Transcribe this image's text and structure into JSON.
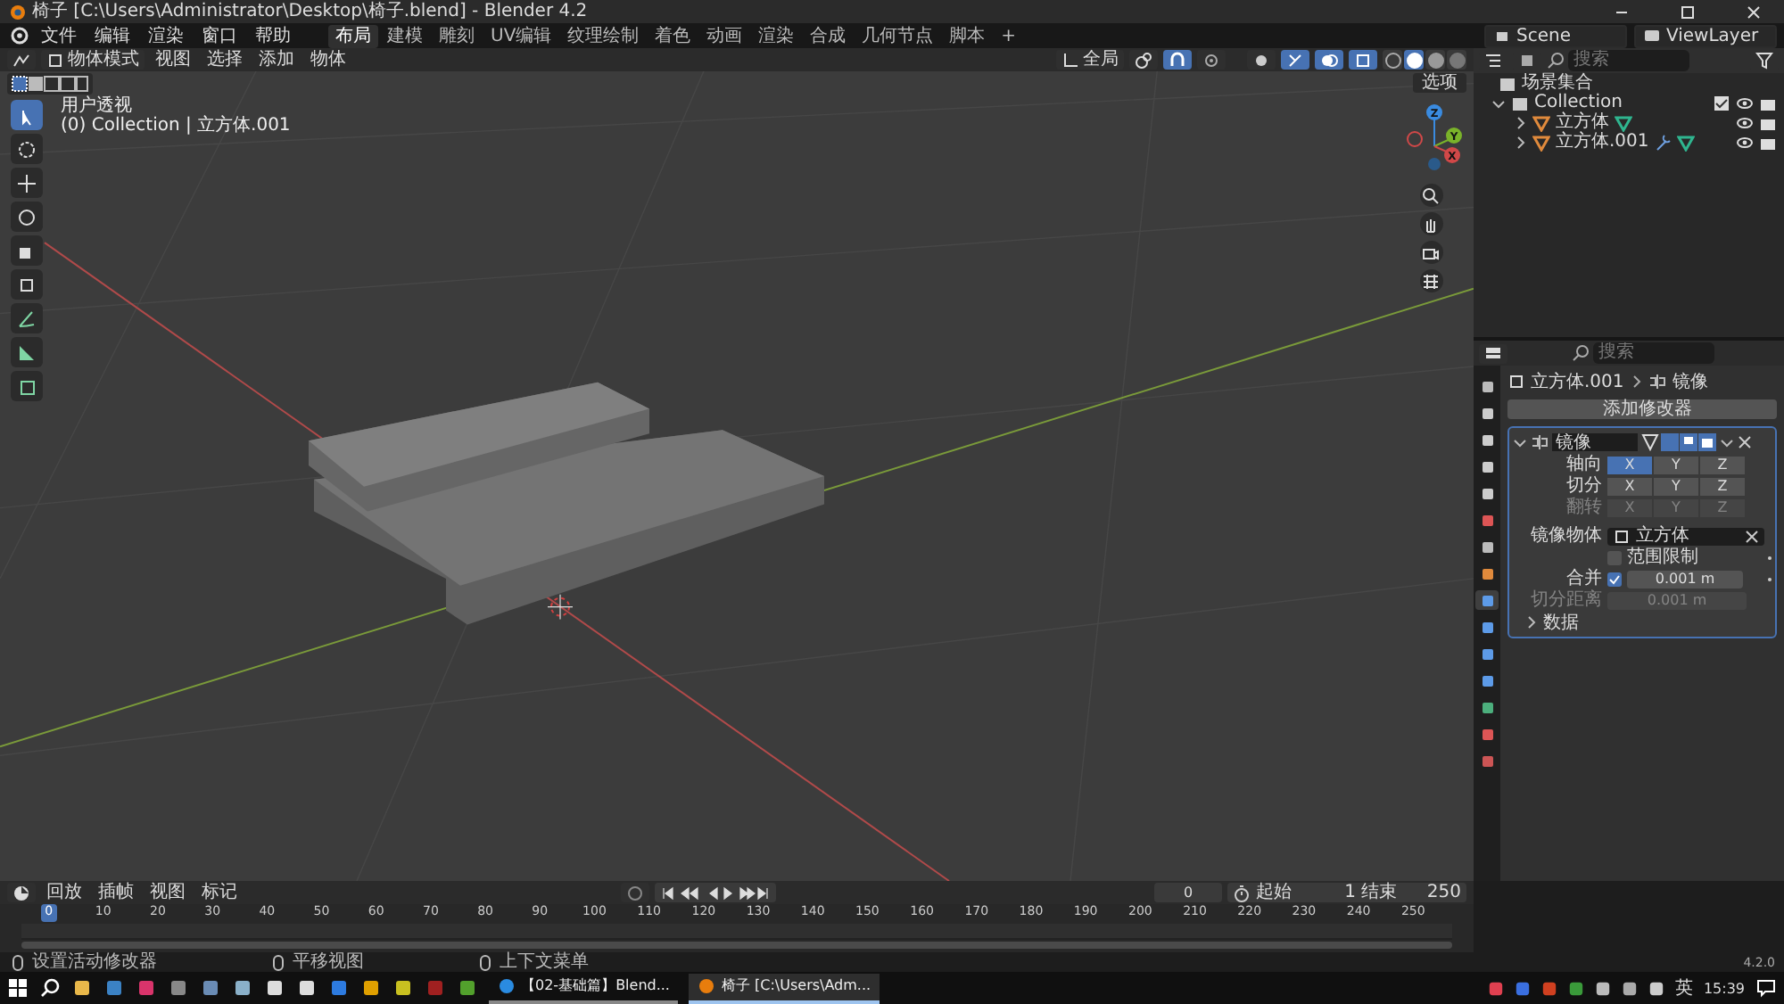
{
  "window": {
    "title": "椅子 [C:\\Users\\Administrator\\Desktop\\椅子.blend] - Blender 4.2"
  },
  "menu": [
    "文件",
    "编辑",
    "渲染",
    "窗口",
    "帮助"
  ],
  "workspaces": [
    {
      "label": "布局",
      "selected": true
    },
    {
      "label": "建模",
      "selected": false
    },
    {
      "label": "雕刻",
      "selected": false
    },
    {
      "label": "UV编辑",
      "selected": false
    },
    {
      "label": "纹理绘制",
      "selected": false
    },
    {
      "label": "着色",
      "selected": false
    },
    {
      "label": "动画",
      "selected": false
    },
    {
      "label": "渲染",
      "selected": false
    },
    {
      "label": "合成",
      "selected": false
    },
    {
      "label": "几何节点",
      "selected": false
    },
    {
      "label": "脚本",
      "selected": false
    }
  ],
  "add_workspace": "+",
  "scene": "Scene",
  "view_layer": "ViewLayer",
  "viewport": {
    "mode": "物体模式",
    "menus": [
      "视图",
      "选择",
      "添加",
      "物体"
    ],
    "orientation": "全局",
    "options": "选项",
    "view_name": "用户透视",
    "view_info": "(0) Collection | 立方体.001",
    "tools": [
      {
        "kind": "select",
        "selected": true
      },
      {
        "kind": "cursor",
        "selected": false
      },
      {
        "kind": "move",
        "selected": false
      },
      {
        "kind": "rotate",
        "selected": false
      },
      {
        "kind": "scale",
        "selected": false
      },
      {
        "kind": "transform",
        "selected": false
      },
      {
        "kind": "annotate",
        "selected": false
      },
      {
        "kind": "measure",
        "selected": false
      },
      {
        "kind": "add",
        "selected": false
      }
    ],
    "shading": [
      {
        "selected": false
      },
      {
        "selected": true
      },
      {
        "selected": false
      },
      {
        "selected": false
      }
    ],
    "gizmo_axes": [
      "Z",
      "Y",
      "X"
    ]
  },
  "outliner": {
    "search_placeholder": "搜索",
    "tree": [
      {
        "label": "场景集合",
        "kind": "scene",
        "children": [
          {
            "label": "Collection",
            "kind": "collection",
            "expanded": true,
            "children": [
              {
                "label": "立方体",
                "kind": "mesh",
                "expanded": false,
                "has_modifier": false
              },
              {
                "label": "立方体.001",
                "kind": "mesh",
                "expanded": false,
                "has_modifier": true
              }
            ]
          }
        ]
      }
    ]
  },
  "properties": {
    "search_placeholder": "搜索",
    "tabs": [
      {
        "selected": false
      },
      {
        "selected": false
      },
      {
        "selected": false
      },
      {
        "selected": false
      },
      {
        "selected": false
      },
      {
        "selected": false
      },
      {
        "selected": false
      },
      {
        "selected": false
      },
      {
        "selected": true
      },
      {
        "selected": false
      },
      {
        "selected": false
      },
      {
        "selected": false
      },
      {
        "selected": false
      },
      {
        "selected": false
      },
      {
        "selected": false
      }
    ],
    "object": "立方体.001",
    "crumb": "镜像",
    "add_modifier": "添加修改器",
    "modifier": {
      "name": "镜像",
      "expanded": true,
      "rows": [
        {
          "label": "轴向",
          "disabled": false,
          "options": [
            {
              "label": "X",
              "selected": true
            },
            {
              "label": "Y",
              "selected": false
            },
            {
              "label": "Z",
              "selected": false
            }
          ]
        },
        {
          "label": "切分",
          "disabled": false,
          "options": [
            {
              "label": "X",
              "selected": false
            },
            {
              "label": "Y",
              "selected": false
            },
            {
              "label": "Z",
              "selected": false
            }
          ]
        },
        {
          "label": "翻转",
          "disabled": true,
          "options": [
            {
              "label": "X",
              "selected": false
            },
            {
              "label": "Y",
              "selected": false
            },
            {
              "label": "Z",
              "selected": false
            }
          ]
        }
      ],
      "mirror_object_label": "镜像物体",
      "mirror_object": "立方体",
      "clipping": {
        "label": "范围限制",
        "checked": false
      },
      "merge": {
        "label": "合并",
        "checked": true,
        "value": "0.001 m"
      },
      "bisect_distance": {
        "label": "切分距离",
        "value": "0.001 m",
        "disabled": true
      },
      "data_panel": "数据"
    }
  },
  "timeline": {
    "menus": [
      "回放",
      "插帧",
      "视图",
      "标记"
    ],
    "current_frame": "0",
    "start_label": "起始",
    "start": "1",
    "end_label": "结束",
    "end": "250",
    "ticks": [
      {
        "label": "0",
        "selected": true
      },
      {
        "label": "10",
        "selected": false
      },
      {
        "label": "20",
        "selected": false
      },
      {
        "label": "30",
        "selected": false
      },
      {
        "label": "40",
        "selected": false
      },
      {
        "label": "50",
        "selected": false
      },
      {
        "label": "60",
        "selected": false
      },
      {
        "label": "70",
        "selected": false
      },
      {
        "label": "80",
        "selected": false
      },
      {
        "label": "90",
        "selected": false
      },
      {
        "label": "100",
        "selected": false
      },
      {
        "label": "110",
        "selected": false
      },
      {
        "label": "120",
        "selected": false
      },
      {
        "label": "130",
        "selected": false
      },
      {
        "label": "140",
        "selected": false
      },
      {
        "label": "150",
        "selected": false
      },
      {
        "label": "160",
        "selected": false
      },
      {
        "label": "170",
        "selected": false
      },
      {
        "label": "180",
        "selected": false
      },
      {
        "label": "190",
        "selected": false
      },
      {
        "label": "200",
        "selected": false
      },
      {
        "label": "210",
        "selected": false
      },
      {
        "label": "220",
        "selected": false
      },
      {
        "label": "230",
        "selected": false
      },
      {
        "label": "240",
        "selected": false
      },
      {
        "label": "250",
        "selected": false
      }
    ]
  },
  "status_bar": {
    "hints": [
      "设置活动修改器",
      "平移视图",
      "上下文菜单"
    ],
    "version": "4.2.0"
  },
  "taskbar": {
    "apps": [
      {
        "label": "【02-基础篇】Blend...",
        "selected": false
      },
      {
        "label": "椅子 [C:\\Users\\Adm...",
        "selected": true
      }
    ],
    "ime": "英",
    "time": "15:39"
  }
}
